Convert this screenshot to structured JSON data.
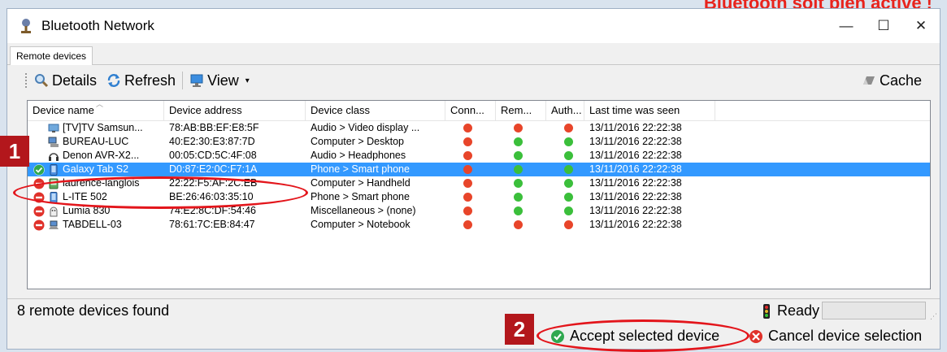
{
  "banner": {
    "text": "Bluetooth soit bien activé !"
  },
  "window": {
    "title": "Bluetooth Network",
    "minimize_glyph": "—",
    "maximize_glyph": "☐",
    "close_glyph": "✕"
  },
  "tabs": [
    {
      "label": "Remote devices",
      "active": true
    }
  ],
  "toolbar": {
    "details_label": "Details",
    "refresh_label": "Refresh",
    "view_label": "View",
    "view_arrow": "▾",
    "cache_label": "Cache"
  },
  "columns": [
    "Device name",
    "Device address",
    "Device class",
    "Conn...",
    "Rem...",
    "Auth...",
    "Last time was seen"
  ],
  "devices": [
    {
      "name": "[TV]TV Samsun...",
      "address": "78:AB:BB:EF:E8:5F",
      "class": "Audio > Video display ...",
      "status": "none",
      "conn": "red",
      "rem": "red",
      "auth": "red",
      "last_seen": "13/11/2016 22:22:38",
      "icon": "tv-icon",
      "selected": false
    },
    {
      "name": "BUREAU-LUC",
      "address": "40:E2:30:E3:87:7D",
      "class": "Computer > Desktop",
      "status": "none",
      "conn": "red",
      "rem": "green",
      "auth": "green",
      "last_seen": "13/11/2016 22:22:38",
      "icon": "desktop-computer-icon",
      "selected": false
    },
    {
      "name": "Denon AVR-X2...",
      "address": "00:05:CD:5C:4F:08",
      "class": "Audio > Headphones",
      "status": "none",
      "conn": "red",
      "rem": "green",
      "auth": "green",
      "last_seen": "13/11/2016 22:22:38",
      "icon": "headphones-icon",
      "selected": false
    },
    {
      "name": "Galaxy Tab S2",
      "address": "D0:87:E2:0C:F7:1A",
      "class": "Phone > Smart phone",
      "status": "ok",
      "conn": "red",
      "rem": "green",
      "auth": "green",
      "last_seen": "13/11/2016 22:22:38",
      "icon": "phone-icon",
      "selected": true
    },
    {
      "name": "laurence-langlois",
      "address": "22:22:F5:AF:2C:EB",
      "class": "Computer > Handheld",
      "status": "blocked",
      "conn": "red",
      "rem": "green",
      "auth": "green",
      "last_seen": "13/11/2016 22:22:38",
      "icon": "handheld-icon",
      "selected": false
    },
    {
      "name": "L-ITE 502",
      "address": "BE:26:46:03:35:10",
      "class": "Phone > Smart phone",
      "status": "blocked",
      "conn": "red",
      "rem": "green",
      "auth": "green",
      "last_seen": "13/11/2016 22:22:38",
      "icon": "phone-icon",
      "selected": false
    },
    {
      "name": "Lumia 830",
      "address": "74:E2:8C:DF:54:46",
      "class": "Miscellaneous > (none)",
      "status": "blocked",
      "conn": "red",
      "rem": "green",
      "auth": "green",
      "last_seen": "13/11/2016 22:22:38",
      "icon": "unknown-device-icon",
      "selected": false
    },
    {
      "name": "TABDELL-03",
      "address": "78:61:7C:EB:84:47",
      "class": "Computer > Notebook",
      "status": "blocked",
      "conn": "red",
      "rem": "red",
      "auth": "red",
      "last_seen": "13/11/2016 22:22:38",
      "icon": "laptop-icon",
      "selected": false
    }
  ],
  "status_bar": {
    "text": "8 remote devices found",
    "ready_label": "Ready"
  },
  "actions": {
    "accept_label": "Accept selected device",
    "cancel_label": "Cancel device selection"
  },
  "annotations": {
    "badge1": "1",
    "badge2": "2"
  },
  "colors": {
    "selection": "#3399ff",
    "dot_red": "#e8452a",
    "dot_green": "#3bbf3b",
    "annotation_red": "#e3151b",
    "badge_bg": "#b3171c"
  }
}
